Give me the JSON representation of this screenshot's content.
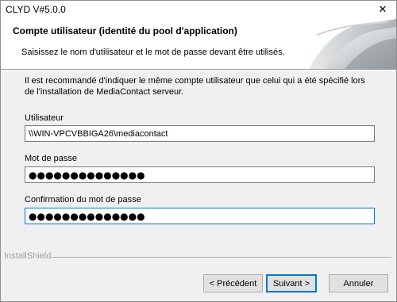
{
  "window": {
    "title": "CLYD V#5.0.0",
    "close_glyph": "✕"
  },
  "header": {
    "title": "Compte utilisateur (identité du pool d'application)",
    "subtitle": "Saisissez le nom d'utilisateur et le mot de passe devant être utilisés."
  },
  "body": {
    "intro": "Il est recommandé d'indiquer le même compte utilisateur que celui qui a été spécifié lors de l'installation de MediaContact serveur."
  },
  "fields": {
    "user_label": "Utilisateur",
    "user_value": "\\\\WIN-VPCVBBIGA26\\mediacontact",
    "password_label": "Mot de passe",
    "password_value": "●●●●●●●●●●●●●●",
    "confirm_label": "Confirmation du mot de passe",
    "confirm_value": "●●●●●●●●●●●●●●"
  },
  "footer": {
    "brand": "InstallShield",
    "back_label": "< Précédent",
    "next_label": "Suivant >",
    "cancel_label": "Annuler"
  },
  "colors": {
    "focus_border": "#0078d7",
    "dialog_bg": "#f0f0f0",
    "header_bg": "#ffffff"
  }
}
